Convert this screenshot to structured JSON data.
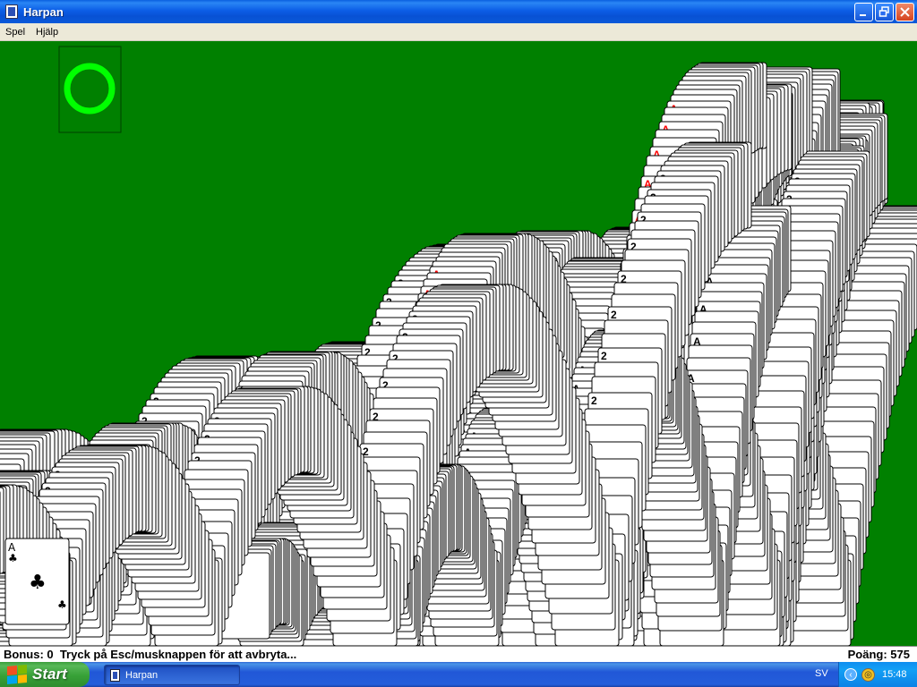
{
  "window": {
    "title": "Harpan",
    "menu": [
      "Spel",
      "Hjälp"
    ]
  },
  "status": {
    "left": "Bonus: 0  Tryck på Esc/musknappen för att avbryta...",
    "right": "Poäng: 575"
  },
  "taskbar": {
    "start_label": "Start",
    "task_label": "Harpan",
    "language": "SV",
    "clock": "15:48"
  },
  "game": {
    "felt_color": "#008000",
    "ring_color": "#00ff00",
    "red_suit_color": "#ff0000",
    "black_suit_color": "#000000",
    "bottom_card_rank": "A",
    "bottom_card_suit": "♣"
  }
}
